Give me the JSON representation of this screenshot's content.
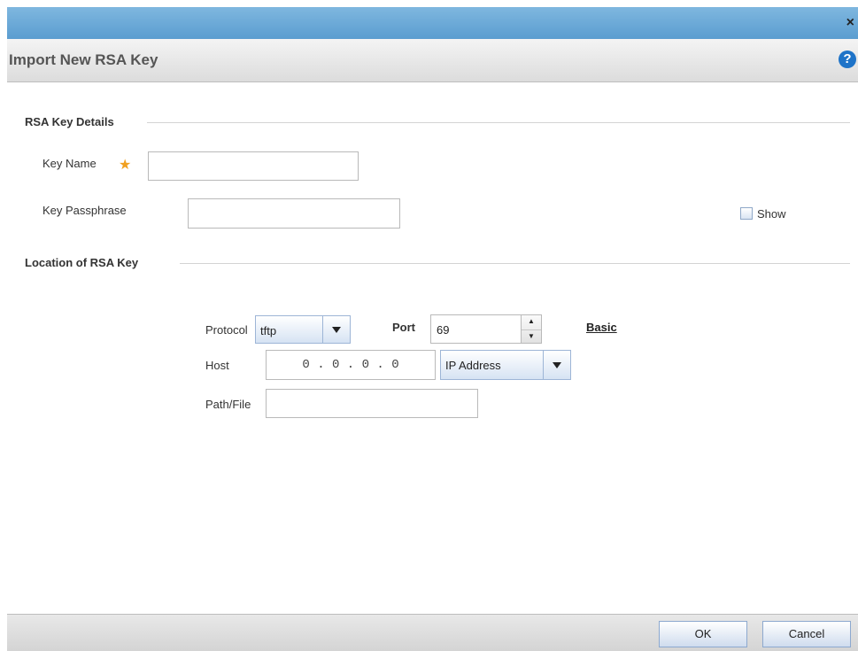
{
  "window": {
    "close_glyph": "×"
  },
  "dialog": {
    "title": "Import New RSA Key",
    "help_glyph": "?"
  },
  "rsa_details": {
    "section_title": "RSA Key Details",
    "key_name_label": "Key Name",
    "key_name_value": "",
    "required_glyph": "★",
    "passphrase_label": "Key Passphrase",
    "passphrase_value": "",
    "show_label": "Show",
    "show_checked": false
  },
  "location": {
    "section_title": "Location of RSA Key",
    "protocol_label": "Protocol",
    "protocol_value": "tftp",
    "port_label": "Port",
    "port_value": "69",
    "basic_link": "Basic",
    "host_label": "Host",
    "host_value": "0 . 0 . 0 . 0",
    "host_type_value": "IP Address",
    "path_label": "Path/File",
    "path_value": ""
  },
  "footer": {
    "ok_label": "OK",
    "cancel_label": "Cancel"
  },
  "colors": {
    "header_blue": "#5b9dd0",
    "required_star": "#f0a020",
    "help_blue": "#1e73c8"
  },
  "icons": {
    "close": "close-icon",
    "help": "help-icon",
    "dropdown": "chevron-down-icon",
    "spinner": "spinner-arrows-icon"
  }
}
